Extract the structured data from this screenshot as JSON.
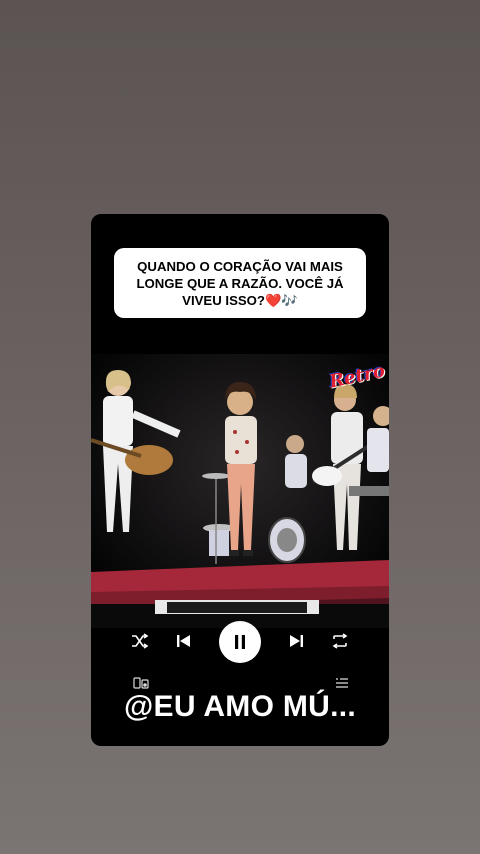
{
  "post": {
    "caption": "QUANDO O CORAÇÃO VAI MAIS LONGE QUE A RAZÃO. VOCÊ JÁ VIVEU ISSO?❤️🎶",
    "badge": "Retro",
    "handle": "@EU AMO MÚ..."
  },
  "player": {
    "state": "playing",
    "controls": [
      "shuffle-icon",
      "previous-icon",
      "pause-icon",
      "next-icon",
      "repeat-icon"
    ],
    "secondary": [
      "devices-icon",
      "queue-icon"
    ]
  },
  "colors": {
    "background": "#625b59",
    "card": "#000000",
    "caption_bg": "#ffffff",
    "control": "#ffffff"
  }
}
